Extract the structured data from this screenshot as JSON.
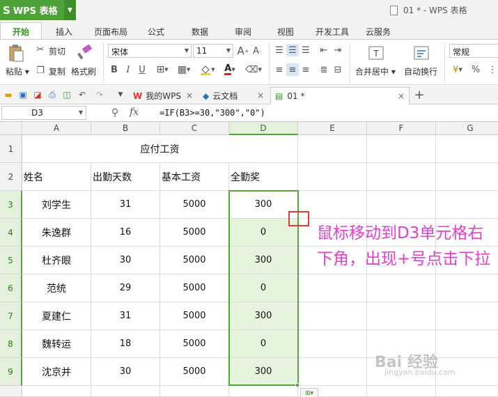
{
  "app": {
    "name": "WPS 表格",
    "window_title": "01 * - WPS 表格"
  },
  "menu": {
    "tabs": [
      "开始",
      "插入",
      "页面布局",
      "公式",
      "数据",
      "审阅",
      "视图",
      "开发工具",
      "云服务"
    ],
    "active": "开始"
  },
  "ribbon": {
    "paste": "粘贴",
    "cut": "剪切",
    "copy": "复制",
    "format_painter": "格式刷",
    "font_name": "宋体",
    "font_size": "11",
    "merge_center": "合并居中",
    "wrap_text": "自动换行",
    "number_format": "常规",
    "percent": "%"
  },
  "doc_tabs": [
    {
      "label": "我的WPS"
    },
    {
      "label": "云文档"
    },
    {
      "label": "01 *"
    }
  ],
  "formula_bar": {
    "name_box": "D3",
    "fx": "fx",
    "formula": "=IF(B3>=30,\"300\",\"0\")"
  },
  "sheet": {
    "columns": [
      "A",
      "B",
      "C",
      "D",
      "E",
      "F",
      "G"
    ],
    "title": "应付工资",
    "headers": [
      "姓名",
      "出勤天数",
      "基本工资",
      "全勤奖"
    ],
    "rows": [
      {
        "row": "3",
        "name": "刘学生",
        "days": "31",
        "base": "5000",
        "bonus": "300"
      },
      {
        "row": "4",
        "name": "朱逸群",
        "days": "16",
        "base": "5000",
        "bonus": "0"
      },
      {
        "row": "5",
        "name": "杜齐眼",
        "days": "30",
        "base": "5000",
        "bonus": "300"
      },
      {
        "row": "6",
        "name": "范统",
        "days": "29",
        "base": "5000",
        "bonus": "0"
      },
      {
        "row": "7",
        "name": "夏建仁",
        "days": "31",
        "base": "5000",
        "bonus": "300"
      },
      {
        "row": "8",
        "name": "魏转运",
        "days": "18",
        "base": "5000",
        "bonus": "0"
      },
      {
        "row": "9",
        "name": "沈京并",
        "days": "30",
        "base": "5000",
        "bonus": "300"
      }
    ]
  },
  "annotation": "鼠标移动到D3单元格右下角，出现+号点击下拉",
  "watermark": {
    "logo": "Bai 经验",
    "url": "jingyan.baidu.com"
  },
  "colors": {
    "wps_green": "#4fa23a",
    "selection": "#5aa23e",
    "annotation": "#e23fc8",
    "marker": "#e03a3a"
  }
}
